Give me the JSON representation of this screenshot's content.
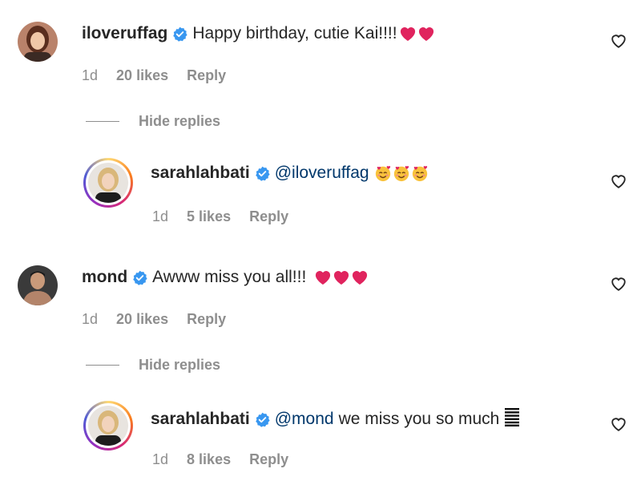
{
  "comments": [
    {
      "username": "iloveruffag",
      "text": "Happy birthday, cutie Kai!!!!",
      "emoji": "❤️❤️",
      "time": "1d",
      "likes": "20 likes",
      "reply_label": "Reply",
      "hide_replies_label": "Hide replies",
      "reply": {
        "username": "sarahlahbati",
        "mention": "@iloveruffag",
        "text": "",
        "emoji": "🥰🥰🥰",
        "time": "1d",
        "likes": "5 likes",
        "reply_label": "Reply"
      }
    },
    {
      "username": "mond",
      "text": "Awww miss you all!!!",
      "emoji": "❤️❤️❤️",
      "time": "1d",
      "likes": "20 likes",
      "reply_label": "Reply",
      "hide_replies_label": "Hide replies",
      "reply": {
        "username": "sarahlahbati",
        "mention": "@mond",
        "text": "we miss you so much",
        "emoji": "≣",
        "time": "1d",
        "likes": "8 likes",
        "reply_label": "Reply"
      }
    }
  ],
  "colors": {
    "verified": "#3897f0",
    "mention": "#00376b",
    "meta": "#8e8e8e",
    "heart_emoji": "#e0245e"
  },
  "icons": {
    "verified": "verified-badge-icon",
    "like": "heart-outline-icon",
    "avatar_ring": "story-ring"
  }
}
